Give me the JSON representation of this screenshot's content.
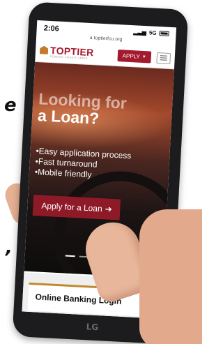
{
  "side_text": {
    "top": "e",
    "bottom": ","
  },
  "status_bar": {
    "time": "2:06",
    "url": "a toptierfcu.org",
    "network": "5G"
  },
  "header": {
    "logo_text": "TOPTIER",
    "logo_subtitle": "FEDERAL CREDIT UNION",
    "apply_label": "APPLY"
  },
  "hero": {
    "title_line1": "Looking for",
    "title_line2": "a Loan?",
    "features": [
      "Easy application process",
      "Fast turnaround",
      "Mobile friendly"
    ],
    "cta_label": "Apply for a Loan"
  },
  "login": {
    "title": "Online Banking Login"
  },
  "device": {
    "brand": "LG"
  },
  "colors": {
    "brand_red": "#a3192e",
    "accent_gold": "#c08a2c"
  },
  "icons": {
    "apply_caret": "caret-down-icon",
    "menu": "hamburger-icon",
    "cta_arrow": "arrow-right-icon"
  }
}
